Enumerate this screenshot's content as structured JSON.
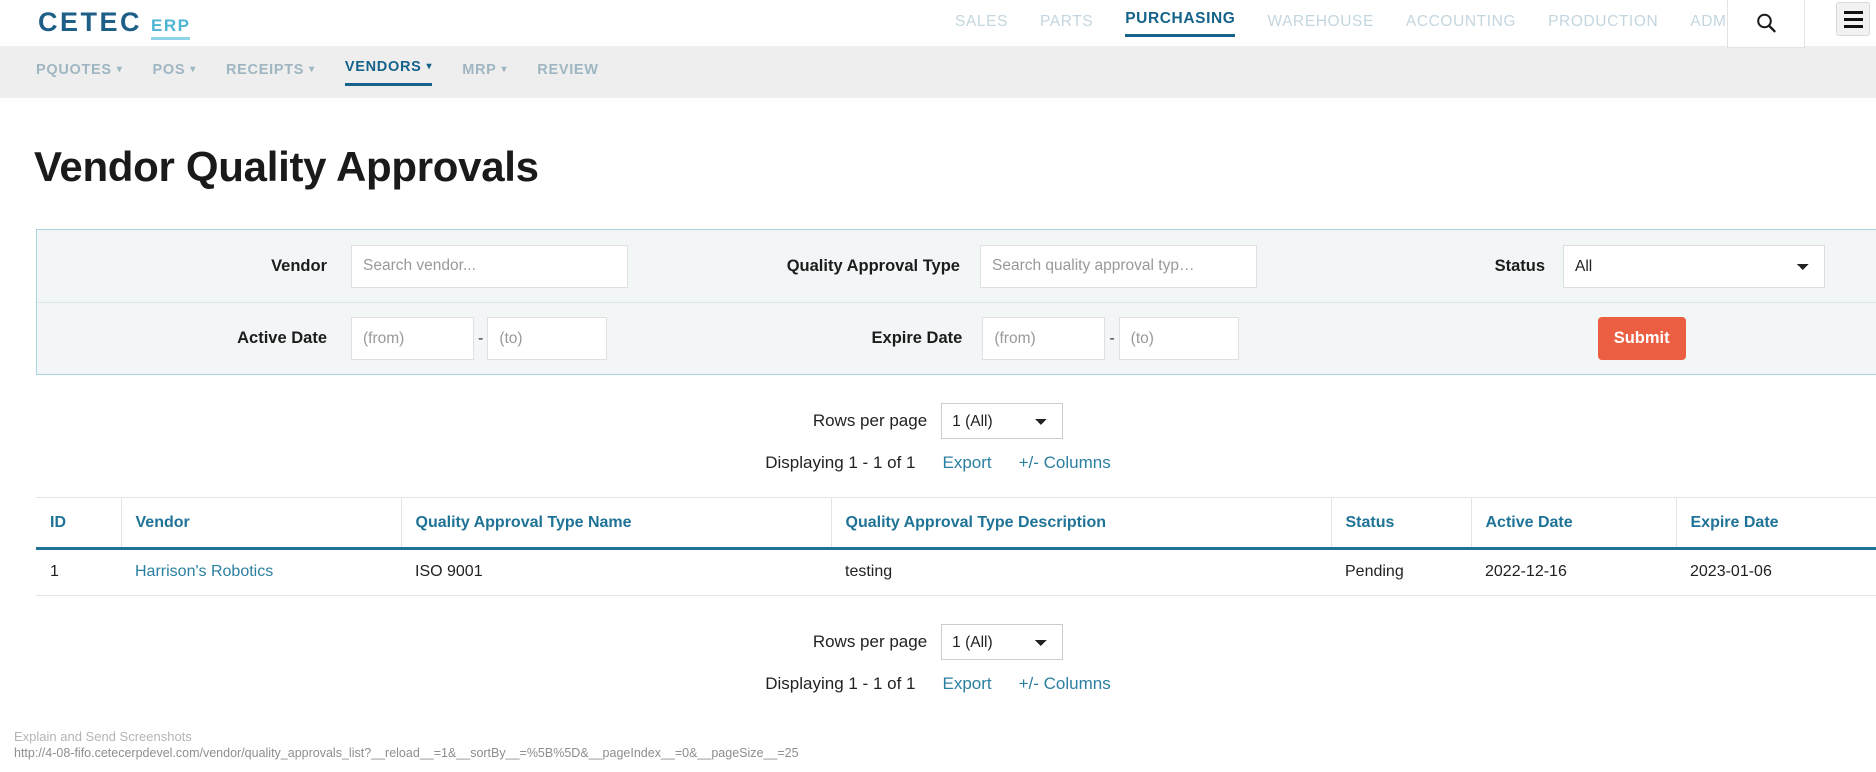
{
  "brand": {
    "name": "CETEC",
    "suffix": "ERP",
    "primary_color": "#15628a",
    "accent_color": "#4db6d4",
    "submit_color": "#eb5e41",
    "link_color": "#2b7fa0"
  },
  "main_nav": {
    "items": [
      {
        "label": "SALES",
        "active": false
      },
      {
        "label": "PARTS",
        "active": false
      },
      {
        "label": "PURCHASING",
        "active": true
      },
      {
        "label": "WAREHOUSE",
        "active": false
      },
      {
        "label": "ACCOUNTING",
        "active": false
      },
      {
        "label": "PRODUCTION",
        "active": false
      },
      {
        "label": "ADMIN",
        "active": false
      }
    ],
    "search_icon": "search-icon",
    "menu_icon": "hamburger-icon"
  },
  "sub_nav": {
    "items": [
      {
        "label": "PQUOTES",
        "caret": "▾",
        "active": false
      },
      {
        "label": "POS",
        "caret": "▾",
        "active": false
      },
      {
        "label": "RECEIPTS",
        "caret": "▾",
        "active": false
      },
      {
        "label": "VENDORS",
        "caret": "▾",
        "active": true
      },
      {
        "label": "MRP",
        "caret": "▾",
        "active": false
      },
      {
        "label": "REVIEW",
        "caret": "",
        "active": false
      }
    ]
  },
  "page": {
    "title": "Vendor Quality Approvals"
  },
  "filters": {
    "vendor": {
      "label": "Vendor",
      "placeholder": "Search vendor...",
      "value": ""
    },
    "quality_approval_type": {
      "label": "Quality Approval Type",
      "placeholder": "Search quality approval typ…",
      "value": ""
    },
    "status": {
      "label": "Status",
      "selected": "All",
      "options": [
        "All"
      ]
    },
    "active_date": {
      "label": "Active Date",
      "from_placeholder": "(from)",
      "to_placeholder": "(to)",
      "separator": "-",
      "from_value": "",
      "to_value": ""
    },
    "expire_date": {
      "label": "Expire Date",
      "from_placeholder": "(from)",
      "to_placeholder": "(to)",
      "separator": "-",
      "from_value": "",
      "to_value": ""
    },
    "submit_label": "Submit"
  },
  "pager_top": {
    "rows_per_page_label": "Rows per page",
    "rows_per_page_selected": "1 (All)",
    "rows_per_page_options": [
      "1 (All)"
    ],
    "displaying": "Displaying 1 - 1 of 1",
    "export_label": "Export",
    "columns_label": "+/- Columns"
  },
  "pager_bottom": {
    "rows_per_page_label": "Rows per page",
    "rows_per_page_selected": "1 (All)",
    "rows_per_page_options": [
      "1 (All)"
    ],
    "displaying": "Displaying 1 - 1 of 1",
    "export_label": "Export",
    "columns_label": "+/- Columns"
  },
  "table": {
    "columns": [
      "ID",
      "Vendor",
      "Quality Approval Type Name",
      "Quality Approval Type Description",
      "Status",
      "Active Date",
      "Expire Date"
    ],
    "rows": [
      {
        "id": "1",
        "vendor": "Harrison's Robotics",
        "type_name": "ISO 9001",
        "type_description": "testing",
        "status": "Pending",
        "active_date": "2022-12-16",
        "expire_date": "2023-01-06"
      }
    ]
  },
  "status_bar": {
    "line1": "Explain and Send Screenshots",
    "line2": "http://4-08-fifo.cetecerpdevel.com/vendor/quality_approvals_list?__reload__=1&__sortBy__=%5B%5D&__pageIndex__=0&__pageSize__=25"
  }
}
